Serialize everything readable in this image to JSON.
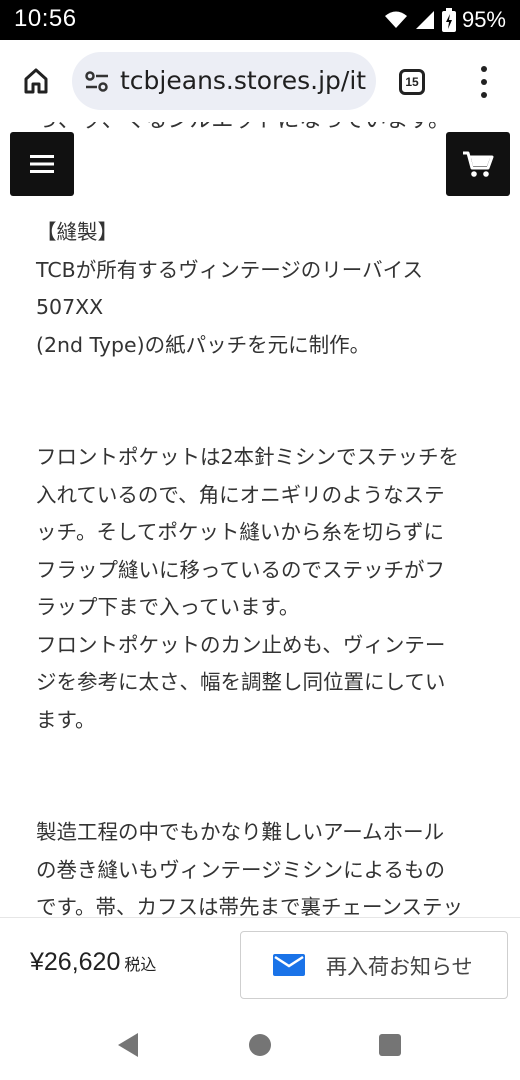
{
  "status_bar": {
    "time": "10:56",
    "battery": "95%",
    "icons": [
      "wifi-icon",
      "signal-icon",
      "battery-charging-icon"
    ]
  },
  "browser": {
    "url": "tcbjeans.stores.jp/it",
    "tab_count": "15",
    "icons": [
      "home-icon",
      "site-settings-icon",
      "more-vert-icon"
    ]
  },
  "content": {
    "cut_text": "っ、ッ、くるシルエットになっています。",
    "paragraphs": [
      {
        "lines": [
          "【縫製】",
          "TCBが所有するヴィンテージのリーバイス",
          "507XX",
          "(2nd Type)の紙パッチを元に制作。"
        ]
      },
      {
        "lines": [
          "フロントポケットは2本針ミシンでステッチを",
          "入れているので、角にオニギリのようなステ",
          "ッチ。そしてポケット縫いから糸を切らずに",
          "フラップ縫いに移っているのでステッチがフ",
          "ラップ下まで入っています。",
          "フロントポケットのカン止めも、ヴィンテー",
          "ジを参考に太さ、幅を調整し同位置にしてい",
          "ます。"
        ]
      },
      {
        "lines": [
          "製造工程の中でもかなり難しいアームホール",
          "の巻き縫いもヴィンテージミシンによるもの",
          "です。帯、カフスは帯先まで裏チェーンステッ"
        ]
      }
    ]
  },
  "floating": {
    "menu_icon": "hamburger-icon",
    "cart_icon": "cart-icon"
  },
  "purchase_bar": {
    "price": "¥26,620",
    "tax_label": "税込",
    "notify_label": "再入荷お知らせ",
    "notify_icon": "mail-icon",
    "accent_color": "#1a73e8"
  },
  "nav_bar": {
    "icons": [
      "back-icon",
      "home-circle-icon",
      "recents-icon"
    ]
  }
}
